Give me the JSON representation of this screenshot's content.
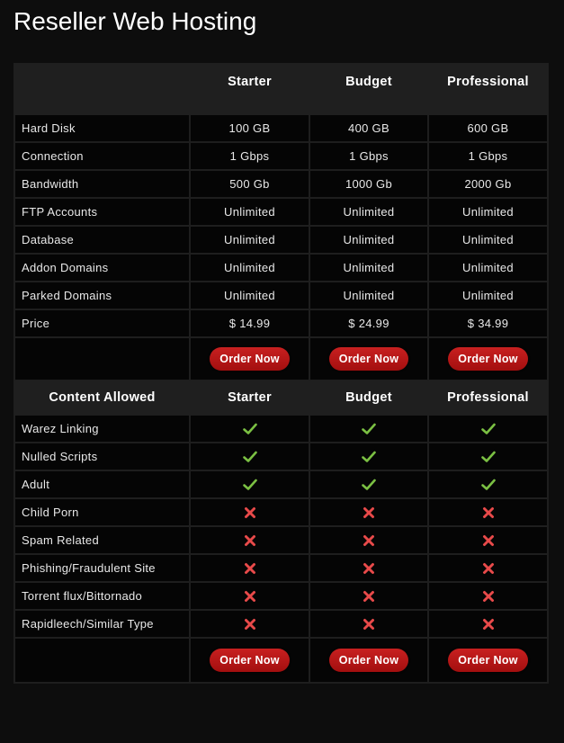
{
  "title": "Reseller Web Hosting",
  "plans": [
    "Starter",
    "Budget",
    "Professional"
  ],
  "features": [
    {
      "label": "Hard Disk",
      "values": [
        "100 GB",
        "400 GB",
        "600 GB"
      ]
    },
    {
      "label": "Connection",
      "values": [
        "1 Gbps",
        "1 Gbps",
        "1 Gbps"
      ]
    },
    {
      "label": "Bandwidth",
      "values": [
        "500 Gb",
        "1000 Gb",
        "2000 Gb"
      ]
    },
    {
      "label": "FTP Accounts",
      "values": [
        "Unlimited",
        "Unlimited",
        "Unlimited"
      ]
    },
    {
      "label": "Database",
      "values": [
        "Unlimited",
        "Unlimited",
        "Unlimited"
      ]
    },
    {
      "label": "Addon Domains",
      "values": [
        "Unlimited",
        "Unlimited",
        "Unlimited"
      ]
    },
    {
      "label": "Parked Domains",
      "values": [
        "Unlimited",
        "Unlimited",
        "Unlimited"
      ]
    },
    {
      "label": "Price",
      "values": [
        "$ 14.99",
        "$ 24.99",
        "$ 34.99"
      ]
    }
  ],
  "order_label": "Order Now",
  "content_header": "Content Allowed",
  "content": [
    {
      "label": "Warez Linking",
      "allowed": true
    },
    {
      "label": "Nulled Scripts",
      "allowed": true
    },
    {
      "label": "Adult",
      "allowed": true
    },
    {
      "label": "Child Porn",
      "allowed": false
    },
    {
      "label": "Spam Related",
      "allowed": false
    },
    {
      "label": "Phishing/Fraudulent Site",
      "allowed": false
    },
    {
      "label": "Torrent flux/Bittornado",
      "allowed": false
    },
    {
      "label": "Rapidleech/Similar Type",
      "allowed": false
    }
  ],
  "icons": {
    "allowed": "check-icon",
    "denied": "cross-icon"
  },
  "colors": {
    "check": "#7bc043",
    "cross": "#e84a4a",
    "button": "#b81515"
  }
}
